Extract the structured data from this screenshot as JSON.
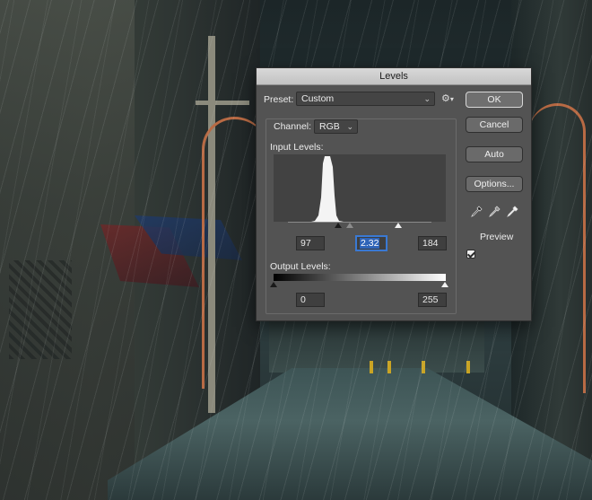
{
  "dialog": {
    "title": "Levels",
    "preset": {
      "label": "Preset:",
      "value": "Custom"
    },
    "channel": {
      "label": "Channel:",
      "value": "RGB"
    },
    "input_levels": {
      "label": "Input Levels:",
      "black": "97",
      "gamma": "2.32",
      "white": "184",
      "black_level": 97,
      "gamma_level": 2.32,
      "white_level": 184
    },
    "output_levels": {
      "label": "Output Levels:",
      "black": "0",
      "white": "255",
      "black_level": 0,
      "white_level": 255
    },
    "buttons": {
      "ok": "OK",
      "cancel": "Cancel",
      "auto": "Auto",
      "options": "Options..."
    },
    "preview": {
      "label": "Preview",
      "checked": true
    },
    "icons": {
      "gear": "gear-icon",
      "eyedroppers": [
        "black-eyedropper-icon",
        "gray-eyedropper-icon",
        "white-eyedropper-icon"
      ]
    },
    "accent_color": "#3a79d3"
  }
}
